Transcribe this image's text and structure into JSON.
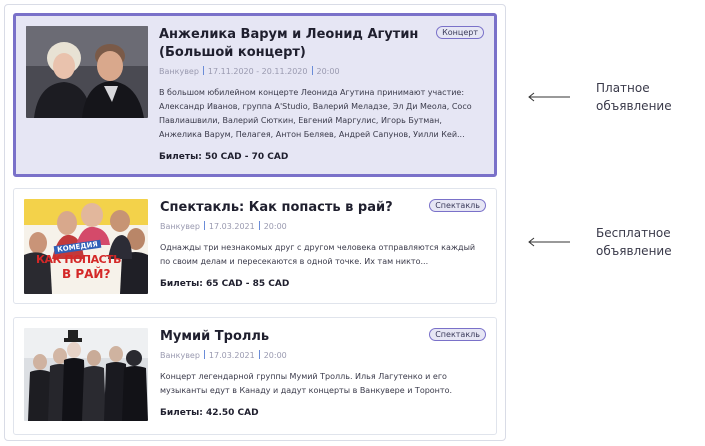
{
  "events": [
    {
      "title": "Анжелика Варум и Леонид Агутин (Большой концерт)",
      "badge": "Концерт",
      "city": "Ванкувер",
      "dates": "17.11.2020 - 20.11.2020",
      "time": "20:00",
      "description": "В большом юбилейном концерте Леонида Агутина принимают участие: Александр Иванов, группа A'Studio, Валерий Меладзе, Эл Ди Меола, Сосо Павлиашвили, Валерий Сюткин, Евгений Маргулис, Игорь Бутман, Анжелика Варум, Пелагея, Антон Беляев, Андрей Сапунов, Уилли Кей...",
      "price": "Билеты: 50 CAD - 70 CAD",
      "image": "concert-photo"
    },
    {
      "title": "Спектакль: Как попасть в рай?",
      "badge": "Спектакль",
      "city": "Ванкувер",
      "dates": "17.03.2021",
      "time": "20:00",
      "description": "Однажды три незнакомых друг с другом человека отправляются каждый по своим делам и пересекаются в одной точке. Их там никто...",
      "price": "Билеты: 65 CAD - 85 CAD",
      "image": "play-poster",
      "poster_text_top": "КОМЕДИЯ",
      "poster_text_main1": "КАК ПОПАСТЬ",
      "poster_text_main2": "В РАЙ?"
    },
    {
      "title": "Мумий Тролль",
      "badge": "Спектакль",
      "city": "Ванкувер",
      "dates": "17.03.2021",
      "time": "20:00",
      "description": "Концерт легендарной группы Мумий Тролль. Илья Лагутенко и его музыканты едут в Канаду и дадут концерты в Ванкувере и Торонто.",
      "price": "Билеты: 42.50 CAD",
      "image": "band-photo"
    }
  ],
  "annotations": {
    "paid_line1": "Платное",
    "paid_line2": "объявление",
    "free_line1": "Бесплатное",
    "free_line2": "объявление"
  },
  "colors": {
    "paid_border": "#7a71c9",
    "paid_background": "#e6e6f4",
    "separator": "#6a8cd8"
  }
}
